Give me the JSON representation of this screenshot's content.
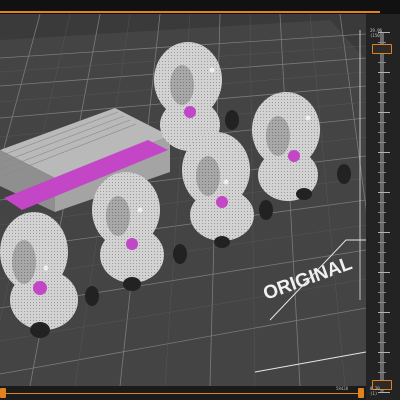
{
  "viewport": {
    "bed_label": "ORIGINAL",
    "objects": [
      {
        "name": "elephant-figurine",
        "kind": "model"
      },
      {
        "name": "support-block",
        "kind": "model"
      }
    ],
    "colors": {
      "bed": "#3d3d3d",
      "grid": "#8a8a8a",
      "model": "#cfcfcf",
      "highlight": "#c246c6",
      "accent": "#e0821d"
    }
  },
  "layer_slider": {
    "top_label": "29.96\n(150)",
    "bottom_label": "0.20\n(1)"
  },
  "move_slider": {
    "value_label": "58428"
  }
}
